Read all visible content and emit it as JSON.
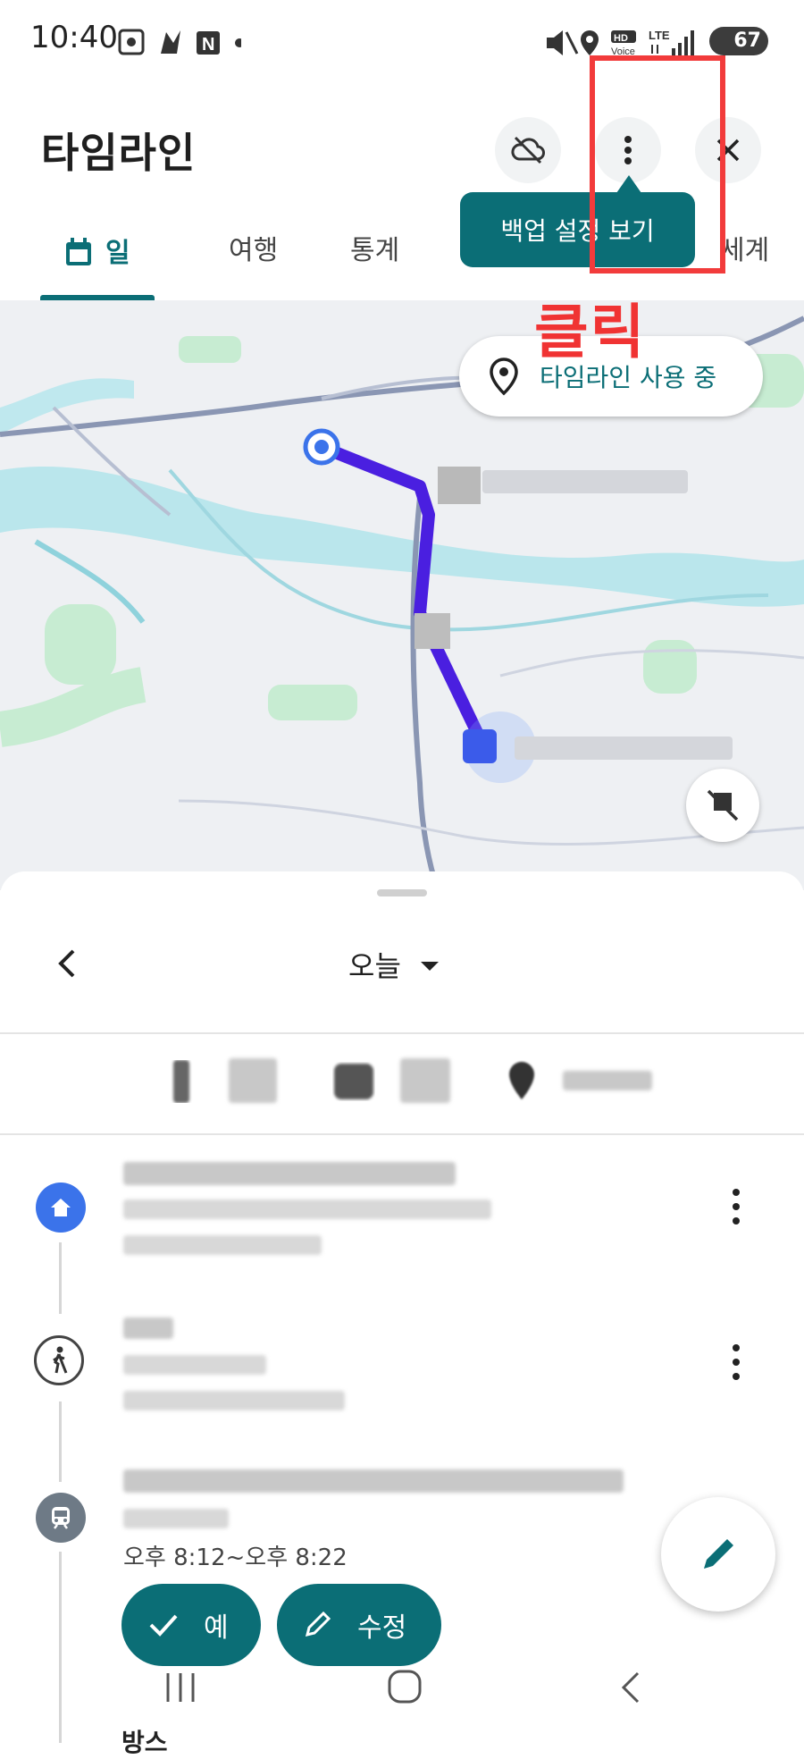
{
  "status_bar": {
    "time": "10:40",
    "battery": "67",
    "network": "LTE",
    "hd_voice": "HD Voice"
  },
  "header": {
    "title": "타임라인"
  },
  "tabs": [
    {
      "label": "일",
      "active": true
    },
    {
      "label": "여행"
    },
    {
      "label": "통계"
    },
    {
      "label": "세계"
    }
  ],
  "tooltip": {
    "text": "백업 설정 보기"
  },
  "annotation": {
    "label": "클릭",
    "color": "#f03333"
  },
  "map": {
    "chip_text": "타임라인 사용 중"
  },
  "sheet": {
    "date_label": "오늘",
    "entries": [
      {
        "icon": "home-icon"
      },
      {
        "icon": "walking-icon"
      },
      {
        "icon": "train-icon",
        "time_text": "오후 8:12~오후 8:22"
      }
    ],
    "confirm_button": "예",
    "edit_button": "수정",
    "next_heading": "방스"
  },
  "colors": {
    "accent": "#0b6e76",
    "route": "#4a1fe0",
    "home_marker": "#3b73ea"
  }
}
